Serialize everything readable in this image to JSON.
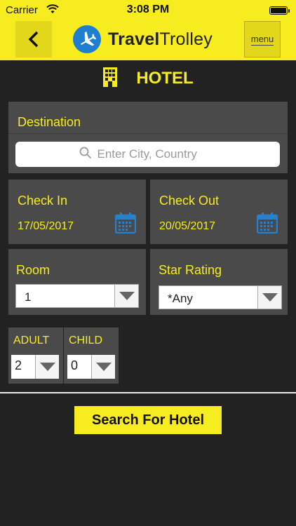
{
  "status_bar": {
    "carrier": "Carrier",
    "time": "3:08 PM"
  },
  "header": {
    "brand_bold": "Travel",
    "brand_light": "Trolley",
    "menu_label": "menu"
  },
  "title": {
    "text": "HOTEL"
  },
  "destination": {
    "label": "Destination",
    "placeholder": "Enter City, Country"
  },
  "check_in": {
    "label": "Check In",
    "date": "17/05/2017"
  },
  "check_out": {
    "label": "Check Out",
    "date": "20/05/2017"
  },
  "room": {
    "label": "Room",
    "selected": "1"
  },
  "star_rating": {
    "label": "Star Rating",
    "selected": "*Any"
  },
  "adult": {
    "label": "ADULT",
    "selected": "2"
  },
  "child": {
    "label": "CHILD",
    "selected": "0"
  },
  "search_button": {
    "label": "Search For Hotel"
  },
  "colors": {
    "accent": "#f7ec1f",
    "background": "#222222",
    "panel": "#4a4a4a",
    "brand_blue": "#1f7ecf"
  },
  "icons": [
    "wifi-icon",
    "battery-icon",
    "back-arrow-icon",
    "plane-logo-icon",
    "hotel-building-icon",
    "search-icon",
    "calendar-icon",
    "dropdown-arrow-icon"
  ]
}
